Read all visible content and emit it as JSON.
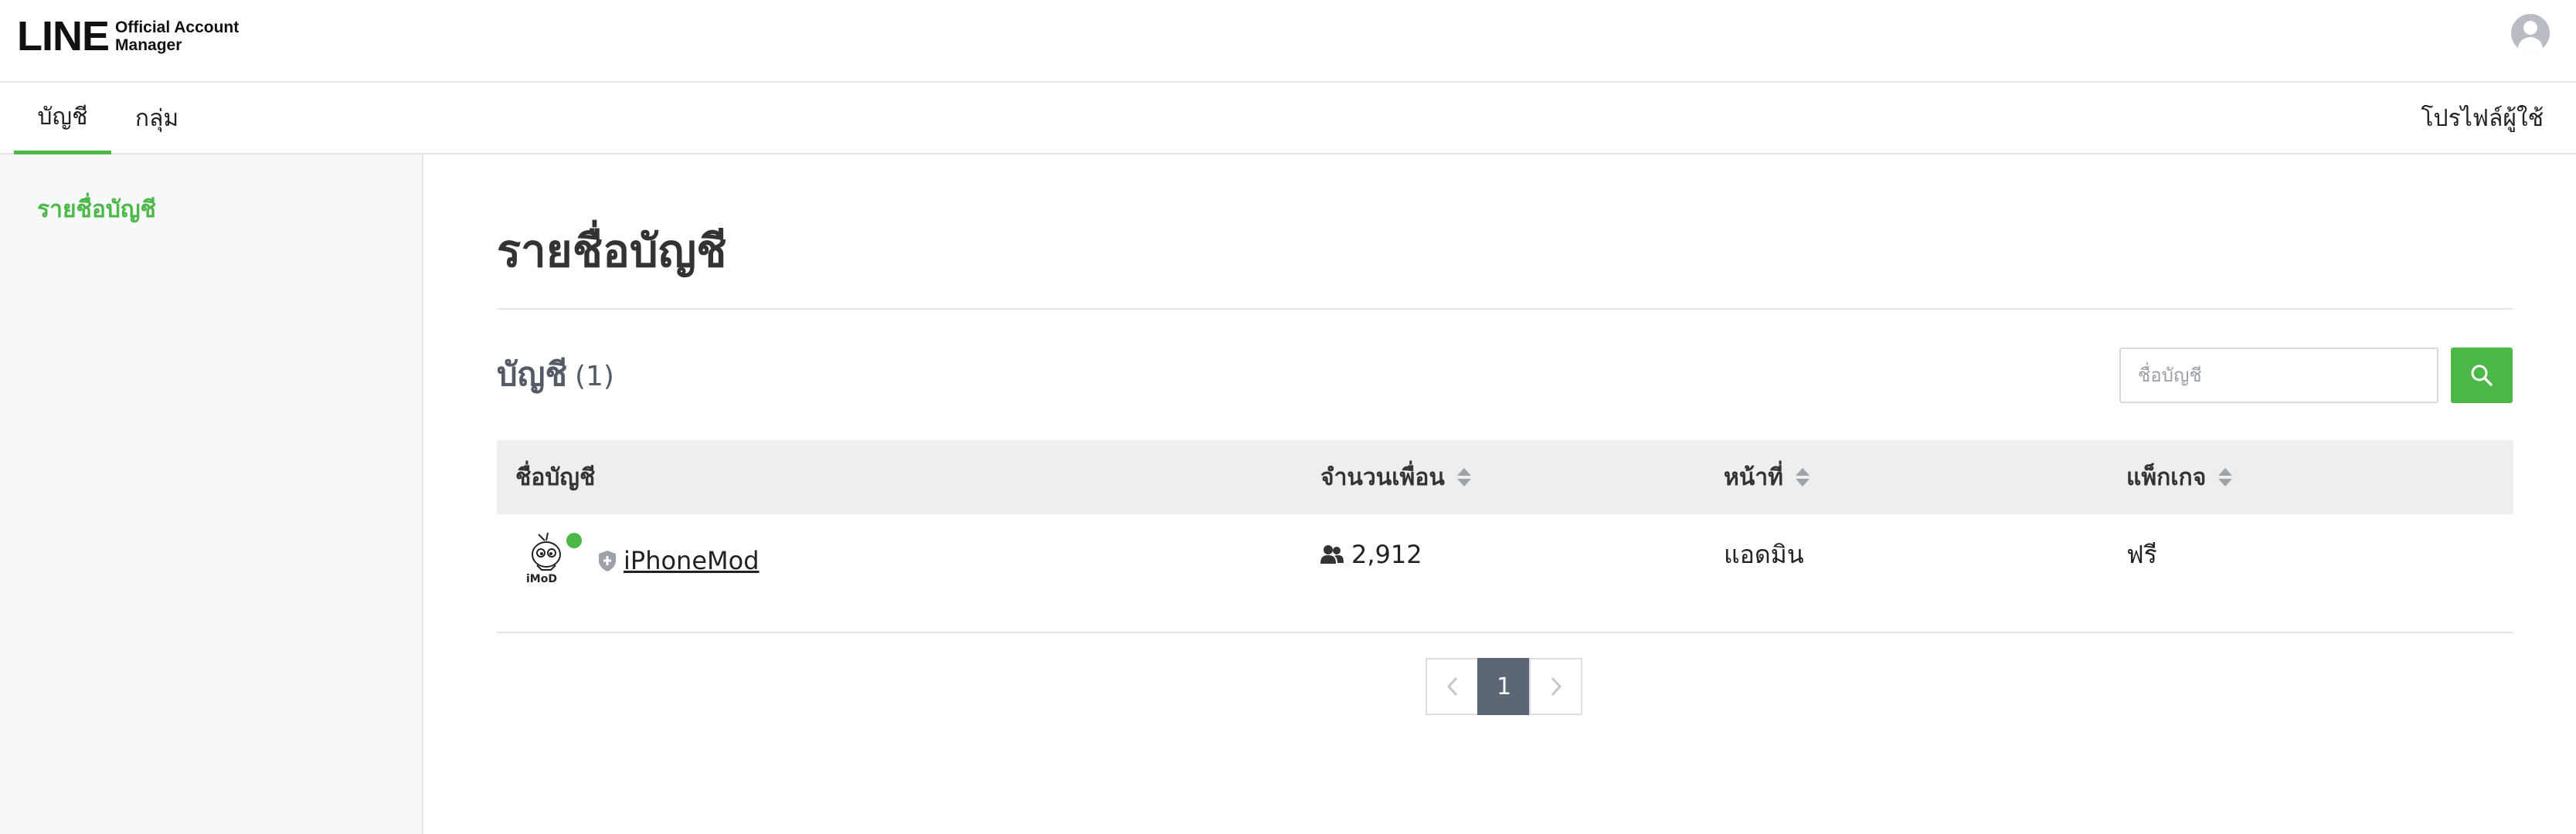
{
  "header": {
    "logo_main": "LINE",
    "logo_sub_1": "Official Account",
    "logo_sub_2": "Manager",
    "avatar_icon": "user-avatar-icon"
  },
  "tabs": [
    {
      "label": "บัญชี",
      "active": true
    },
    {
      "label": "กลุ่ม",
      "active": false
    }
  ],
  "user_profile_label": "โปรไฟล์ผู้ใช้",
  "sidebar": {
    "items": [
      {
        "label": "รายชื่อบัญชี",
        "active": true
      }
    ]
  },
  "main": {
    "title": "รายชื่อบัญชี",
    "section_title": "บัญชี",
    "section_count": "(1)",
    "search": {
      "placeholder": "ชื่อบัญชี",
      "value": "",
      "button_icon": "search-icon"
    },
    "table": {
      "columns": [
        {
          "label": "ชื่อบัญชี",
          "sortable": false
        },
        {
          "label": "จำนวนเพื่อน",
          "sortable": true
        },
        {
          "label": "หน้าที่",
          "sortable": true
        },
        {
          "label": "แพ็กเกจ",
          "sortable": true
        }
      ],
      "rows": [
        {
          "avatar_text": "iMoD",
          "status": "online",
          "verified_icon": "shield-icon",
          "name": "iPhoneMod",
          "friends": "2,912",
          "friends_icon": "users-icon",
          "role": "แอดมิน",
          "plan": "ฟรี"
        }
      ]
    },
    "pagination": {
      "prev_icon": "chevron-left-icon",
      "current": "1",
      "next_icon": "chevron-right-icon"
    }
  },
  "colors": {
    "accent": "#4cb848",
    "pagination_active": "#5d6675",
    "table_header_bg": "#edeef0",
    "sidebar_bg": "#f7f8fa"
  }
}
